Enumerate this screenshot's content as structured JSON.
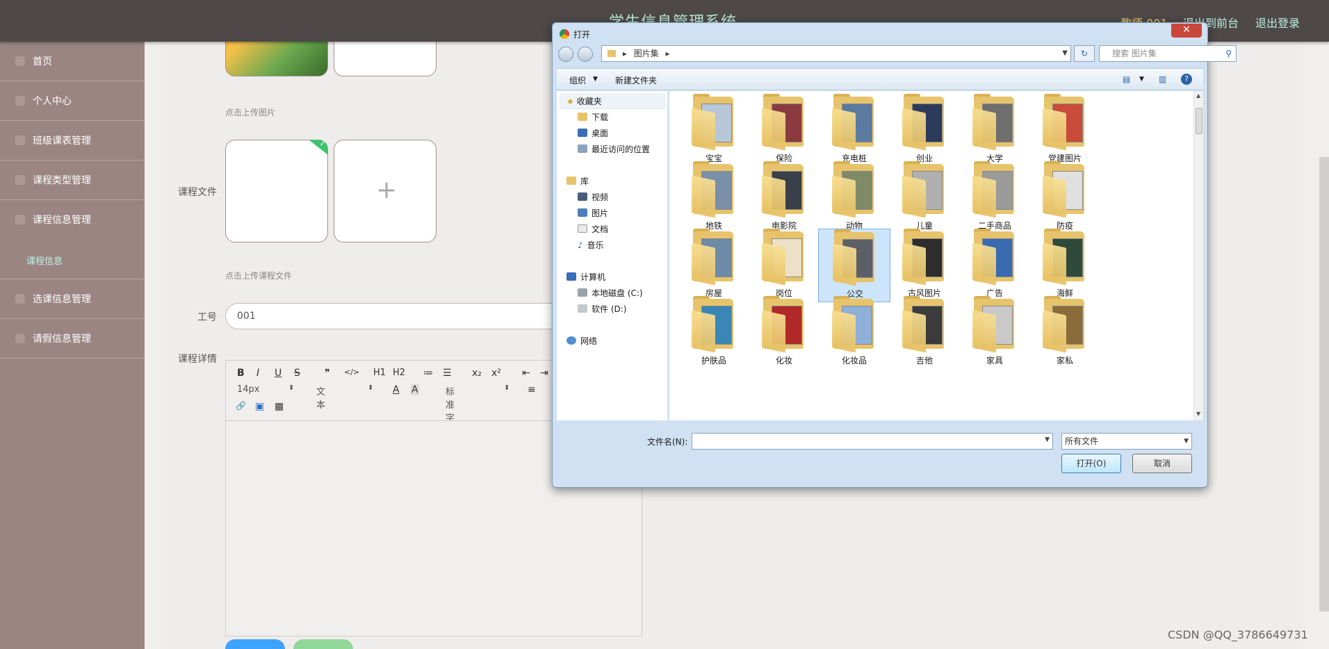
{
  "header": {
    "app_title": "学生信息管理系统",
    "user_label": "教师 001",
    "front_link": "退出到前台",
    "logout_link": "退出登录"
  },
  "sidebar": {
    "items": [
      {
        "label": "首页"
      },
      {
        "label": "个人中心"
      },
      {
        "label": "班级课表管理"
      },
      {
        "label": "课程类型管理"
      },
      {
        "label": "课程信息管理"
      },
      {
        "label": "课程信息"
      },
      {
        "label": "选课信息管理"
      },
      {
        "label": "请假信息管理"
      }
    ]
  },
  "form": {
    "image_hint": "点击上传图片",
    "file_label": "课程文件",
    "file_hint": "点击上传课程文件",
    "plus_glyph": "+",
    "check_glyph": "✓",
    "gonghao_label": "工号",
    "gonghao_value": "001",
    "detail_label": "课程详情",
    "editor": {
      "row1": [
        "B",
        "I",
        "U",
        "S",
        "❞",
        "</>",
        "H1",
        "H2",
        "≔",
        "☰",
        "x₂",
        "x²",
        "⇤",
        "⇥"
      ],
      "font_size": "14px",
      "block_type": "文本",
      "font_family": "标准字体",
      "font_color_glyph": "A",
      "bg_color_glyph": "A",
      "align_glyph": "≡",
      "link_glyph": "🔗",
      "image_glyph": "▣",
      "video_glyph": "▦"
    }
  },
  "dialog": {
    "title": "打开",
    "close_glyph": "✕",
    "address_path": "图片集",
    "search_placeholder": "搜索 图片集",
    "organize": "组织",
    "new_folder": "新建文件夹",
    "nav": {
      "favorites": "收藏夹",
      "favorites_items": [
        "下载",
        "桌面",
        "最近访问的位置"
      ],
      "libraries": "库",
      "library_items": [
        "视频",
        "图片",
        "文档",
        "音乐"
      ],
      "computer": "计算机",
      "drives": [
        "本地磁盘 (C:)",
        "软件 (D:)"
      ],
      "network": "网络"
    },
    "folders": [
      "宝宝",
      "保险",
      "充电桩",
      "创业",
      "大学",
      "党建图片",
      "地铁",
      "电影院",
      "动物",
      "儿童",
      "二手商品",
      "防疫",
      "房屋",
      "岗位",
      "公交",
      "古风图片",
      "广告",
      "海鲜",
      "护肤品",
      "化妆",
      "化妆品",
      "吉他",
      "家具",
      "家私"
    ],
    "selected_folder": "公交",
    "filename_label": "文件名(N):",
    "filename_value": "",
    "filetype_value": "所有文件",
    "open_button": "打开(O)",
    "cancel_button": "取消"
  },
  "watermark": "CSDN @QQ_3786649731",
  "colors": {
    "header_bg": "#4e4848",
    "sidebar_bg": "#9b8583",
    "accent_link": "#bdeee3",
    "user_gold": "#e5c86f",
    "primary_button": "#3ea3ff",
    "secondary_button": "#91d79a",
    "folder_yellow": "#e7c46c"
  }
}
